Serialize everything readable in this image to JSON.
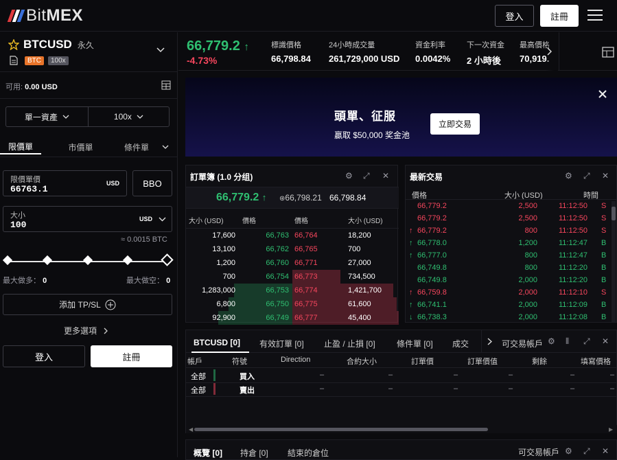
{
  "nav": {
    "brand_prefix": "Bit",
    "brand_suffix": "MEX",
    "login": "登入",
    "register": "註冊"
  },
  "symbol": {
    "name": "BTCUSD",
    "type": "永久",
    "base_badge": "BTC",
    "leverage_badge": "100x"
  },
  "account": {
    "available_label": "可用:",
    "available_value": "0.00 USD"
  },
  "margin": {
    "mode": "單一資產",
    "leverage": "100x"
  },
  "order_tabs": [
    "限價單",
    "市價單",
    "條件單"
  ],
  "limit_price": {
    "label": "限價單價",
    "value": "66763.1",
    "unit": "USD",
    "bbo": "BBO"
  },
  "size": {
    "label": "大小",
    "value": "100",
    "unit": "USD",
    "approx": "≈ 0.0015 BTC"
  },
  "max": {
    "long_label": "最大做多：",
    "long_value": "0",
    "short_label": "最大做空：",
    "short_value": "0"
  },
  "tpsl": "添加 TP/SL",
  "more_options": "更多選項",
  "bottom_buttons": {
    "login": "登入",
    "register": "註冊"
  },
  "ticker": {
    "price": "66,779.2",
    "change": "-4.73%",
    "stats": [
      {
        "label": "標識價格",
        "value": "66,798.84"
      },
      {
        "label": "24小時成交量",
        "value": "261,729,000 USD"
      },
      {
        "label": "資金利率",
        "value": "0.0042%"
      },
      {
        "label": "下一次資金",
        "value": "2 小時後"
      },
      {
        "label": "最高價格",
        "value": "70,919."
      }
    ]
  },
  "banner": {
    "title": "頭單、征服",
    "subtitle": "贏取 $50,000 奖金池",
    "cta": "立即交易"
  },
  "orderbook": {
    "title": "訂單簿 (1.0 分组)",
    "last_price": "66,779.2",
    "mark_price": "66,798.21",
    "index_price": "66,798.84",
    "headers": [
      "大小 (USD)",
      "價格",
      "價格",
      "大小 (USD)"
    ],
    "rows": [
      {
        "bid_size": "17,600",
        "bid_price": "66,763",
        "ask_price": "66,764",
        "ask_size": "18,200"
      },
      {
        "bid_size": "13,100",
        "bid_price": "66,762",
        "ask_price": "66,765",
        "ask_size": "700"
      },
      {
        "bid_size": "1,200",
        "bid_price": "66,760",
        "ask_price": "66,771",
        "ask_size": "27,000"
      },
      {
        "bid_size": "700",
        "bid_price": "66,754",
        "ask_price": "66,773",
        "ask_size": "734,500"
      },
      {
        "bid_size": "1,283,000",
        "bid_price": "66,753",
        "ask_price": "66,774",
        "ask_size": "1,421,700"
      },
      {
        "bid_size": "6,800",
        "bid_price": "66,750",
        "ask_price": "66,775",
        "ask_size": "61,600"
      },
      {
        "bid_size": "92,900",
        "bid_price": "66,749",
        "ask_price": "66,777",
        "ask_size": "45,400"
      }
    ]
  },
  "trades": {
    "title": "最新交易",
    "headers": [
      "價格",
      "大小 (USD)",
      "時間"
    ],
    "rows": [
      {
        "price": "66,779.2",
        "size": "2,500",
        "time": "11:12:50",
        "side": "S",
        "dir": ""
      },
      {
        "price": "66,779.2",
        "size": "2,500",
        "time": "11:12:50",
        "side": "S",
        "dir": ""
      },
      {
        "price": "66,779.2",
        "size": "800",
        "time": "11:12:50",
        "side": "S",
        "dir": "↑"
      },
      {
        "price": "66,778.0",
        "size": "1,200",
        "time": "11:12:47",
        "side": "B",
        "dir": "↑"
      },
      {
        "price": "66,777.0",
        "size": "800",
        "time": "11:12:47",
        "side": "B",
        "dir": "↑"
      },
      {
        "price": "66,749.8",
        "size": "800",
        "time": "11:12:20",
        "side": "B",
        "dir": ""
      },
      {
        "price": "66,749.8",
        "size": "2,000",
        "time": "11:12:20",
        "side": "B",
        "dir": ""
      },
      {
        "price": "66,759.8",
        "size": "2,000",
        "time": "11:12:10",
        "side": "S",
        "dir": "↑"
      },
      {
        "price": "66,741.1",
        "size": "2,000",
        "time": "11:12:09",
        "side": "B",
        "dir": "↑"
      },
      {
        "price": "66,738.3",
        "size": "2,000",
        "time": "11:12:08",
        "side": "B",
        "dir": "↓"
      }
    ]
  },
  "positions": {
    "tabs": [
      "BTCUSD [0]",
      "有效訂單 [0]",
      "止盈 / 止損 [0]",
      "條件單 [0]",
      "成交"
    ],
    "right_label": "可交易帳戶",
    "columns": [
      "帳戶",
      "符號",
      "Direction",
      "合約大小",
      "訂單價",
      "訂單價值",
      "剩餘",
      "填寫價格"
    ],
    "rows": [
      {
        "account": "全部",
        "side": "買入",
        "dash": "–"
      },
      {
        "account": "全部",
        "side": "賣出",
        "dash": "–"
      }
    ]
  },
  "overview": {
    "tabs": [
      "概覽 [0]",
      "持倉 [0]",
      "結束的倉位"
    ],
    "right_label": "可交易帳戶"
  },
  "colors": {
    "up": "#2fbf71",
    "down": "#f6465d",
    "badge_btc": "#e8742a"
  }
}
